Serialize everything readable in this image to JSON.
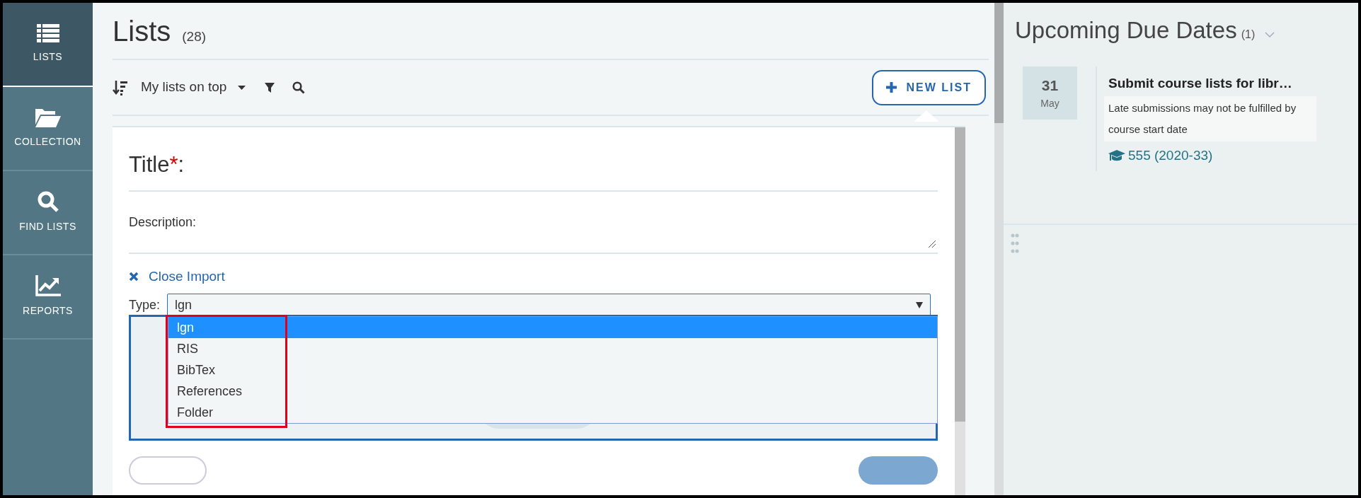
{
  "sidebar": {
    "items": [
      {
        "label": "LISTS",
        "selected": true
      },
      {
        "label": "COLLECTION",
        "selected": false
      },
      {
        "label": "FIND LISTS",
        "selected": false
      },
      {
        "label": "REPORTS",
        "selected": false
      }
    ]
  },
  "header": {
    "title": "Lists",
    "count": "(28)"
  },
  "toolbar": {
    "sort_label": "My lists on top",
    "new_list_button": "NEW LIST"
  },
  "form": {
    "title_label": "Title",
    "required_mark": "*",
    "title_suffix": ":",
    "description_label": "Description:",
    "close_import": "Close Import",
    "type_label": "Type:",
    "type_value": "lgn",
    "expanded": true,
    "annotation_box": true,
    "type_options": [
      {
        "label": "lgn",
        "selected": true
      },
      {
        "label": "RIS",
        "selected": false
      },
      {
        "label": "BibTex",
        "selected": false
      },
      {
        "label": "References",
        "selected": false
      },
      {
        "label": "Folder",
        "selected": false
      }
    ]
  },
  "due_dates": {
    "title": "Upcoming Due Dates",
    "count": "(1)",
    "items": [
      {
        "day": "31",
        "month": "May",
        "title": "Submit course lists for libr…",
        "note": "Late submissions may not be fulfilled by course start date",
        "course": "555 (2020-33)"
      }
    ]
  }
}
